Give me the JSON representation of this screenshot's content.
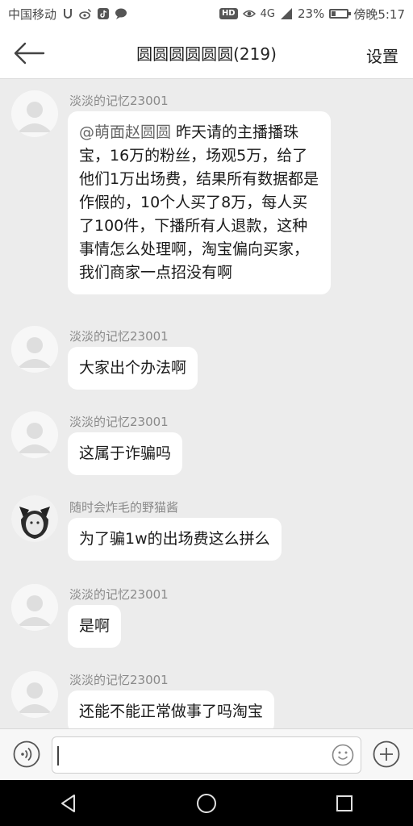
{
  "status_bar": {
    "carrier": "中国移动",
    "network": "4G",
    "battery": "23%",
    "battery_level": 0.23,
    "time": "傍晚5:17",
    "hd": "HD"
  },
  "header": {
    "back_icon": "arrow-left-icon",
    "title": "圆圆圆圆圆圆(219)",
    "settings_label": "设置"
  },
  "messages": [
    {
      "sender": "淡淡的记忆23001",
      "mention": "@萌面赵圆圆",
      "text": " 昨天请的主播播珠宝，16万的粉丝，场观5万，给了他们1万出场费，结果所有数据都是作假的，10个人买了8万，每人买了100件，下播所有人退款，这种事情怎么处理啊，淘宝偏向买家，我们商家一点招没有啊"
    },
    {
      "sender": "淡淡的记忆23001",
      "text": "大家出个办法啊"
    },
    {
      "sender": "淡淡的记忆23001",
      "text": "这属于诈骗吗"
    },
    {
      "sender": "随时会炸毛的野猫酱",
      "text": "为了骗1w的出场费这么拼么"
    },
    {
      "sender": "淡淡的记忆23001",
      "text": "是啊"
    },
    {
      "sender": "淡淡的记忆23001",
      "text": "还能不能正常做事了吗淘宝"
    }
  ],
  "input_bar": {
    "voice_icon": "voice-icon",
    "emoji_icon": "emoji-icon",
    "plus_icon": "plus-icon",
    "value": ""
  },
  "nav_bar": {
    "back_icon": "triangle-back-icon",
    "home_icon": "circle-home-icon",
    "recents_icon": "square-recents-icon"
  }
}
